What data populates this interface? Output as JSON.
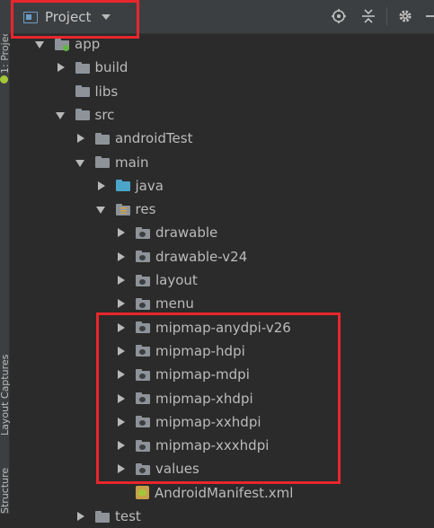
{
  "left_strip": {
    "tabs": [
      "1: Project",
      "Layout Captures",
      "Structure"
    ]
  },
  "header": {
    "view_mode": "Project",
    "icons": [
      "locate-icon",
      "collapse-all-icon",
      "gear-icon",
      "hide-icon"
    ]
  },
  "tree": {
    "rows": [
      {
        "label": "app",
        "depth": 0,
        "expanded": true,
        "icon": "module-folder"
      },
      {
        "label": "build",
        "depth": 1,
        "expanded": false,
        "icon": "folder"
      },
      {
        "label": "libs",
        "depth": 1,
        "expanded": null,
        "icon": "folder"
      },
      {
        "label": "src",
        "depth": 1,
        "expanded": true,
        "icon": "folder"
      },
      {
        "label": "androidTest",
        "depth": 2,
        "expanded": false,
        "icon": "folder"
      },
      {
        "label": "main",
        "depth": 2,
        "expanded": true,
        "icon": "folder"
      },
      {
        "label": "java",
        "depth": 3,
        "expanded": false,
        "icon": "java-folder"
      },
      {
        "label": "res",
        "depth": 3,
        "expanded": true,
        "icon": "res-folder"
      },
      {
        "label": "drawable",
        "depth": 4,
        "expanded": false,
        "icon": "res-dir"
      },
      {
        "label": "drawable-v24",
        "depth": 4,
        "expanded": false,
        "icon": "res-dir"
      },
      {
        "label": "layout",
        "depth": 4,
        "expanded": false,
        "icon": "res-dir"
      },
      {
        "label": "menu",
        "depth": 4,
        "expanded": false,
        "icon": "res-dir"
      },
      {
        "label": "mipmap-anydpi-v26",
        "depth": 4,
        "expanded": false,
        "icon": "res-dir"
      },
      {
        "label": "mipmap-hdpi",
        "depth": 4,
        "expanded": false,
        "icon": "res-dir"
      },
      {
        "label": "mipmap-mdpi",
        "depth": 4,
        "expanded": false,
        "icon": "res-dir"
      },
      {
        "label": "mipmap-xhdpi",
        "depth": 4,
        "expanded": false,
        "icon": "res-dir"
      },
      {
        "label": "mipmap-xxhdpi",
        "depth": 4,
        "expanded": false,
        "icon": "res-dir"
      },
      {
        "label": "mipmap-xxxhdpi",
        "depth": 4,
        "expanded": false,
        "icon": "res-dir"
      },
      {
        "label": "values",
        "depth": 4,
        "expanded": false,
        "icon": "res-dir"
      },
      {
        "label": "AndroidManifest.xml",
        "depth": 4,
        "expanded": null,
        "icon": "manifest-file"
      },
      {
        "label": "test",
        "depth": 2,
        "expanded": false,
        "icon": "folder"
      }
    ]
  },
  "colors": {
    "background": "#2b2b2b",
    "toolbar": "#3c3f41",
    "highlight": "#e8262c",
    "java_folder": "#4aa5c9"
  }
}
